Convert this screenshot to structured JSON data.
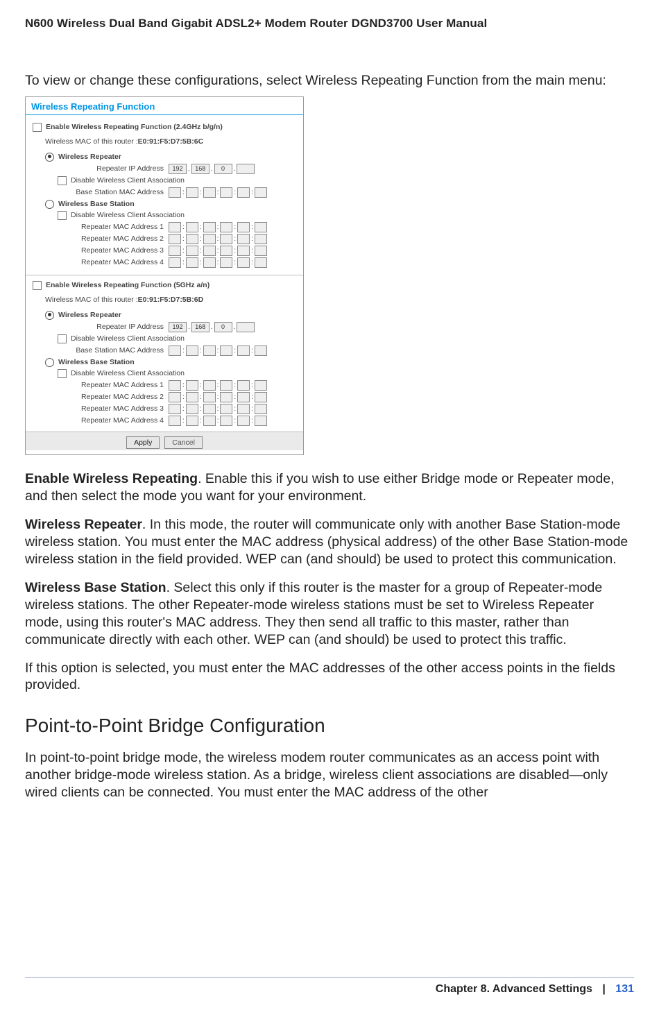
{
  "header": {
    "title": "N600 Wireless Dual Band Gigabit ADSL2+ Modem Router DGND3700 User Manual"
  },
  "intro": "To view or change these configurations, select Wireless Repeating Function from the main menu:",
  "screenshot": {
    "title": "Wireless Repeating Function",
    "band24": {
      "enable_label": "Enable Wireless Repeating Function (2.4GHz b/g/n)",
      "mac_line_prefix": "Wireless MAC of this router : ",
      "mac_value": "E0:91:F5:D7:5B:6C",
      "repeater_label": "Wireless Repeater",
      "repeater_ip_label": "Repeater IP Address",
      "ip_octets": [
        "192",
        "168",
        "0",
        ""
      ],
      "disable_assoc_label": "Disable Wireless Client Association",
      "base_mac_label": "Base Station MAC Address",
      "base_station_label": "Wireless Base Station",
      "rep_mac_labels": [
        "Repeater MAC Address 1",
        "Repeater MAC Address 2",
        "Repeater MAC Address 3",
        "Repeater MAC Address 4"
      ]
    },
    "band5": {
      "enable_label": "Enable Wireless Repeating Function (5GHz a/n)",
      "mac_line_prefix": "Wireless MAC of this router : ",
      "mac_value": "E0:91:F5:D7:5B:6D",
      "repeater_label": "Wireless Repeater",
      "repeater_ip_label": "Repeater IP Address",
      "ip_octets": [
        "192",
        "168",
        "0",
        ""
      ],
      "disable_assoc_label": "Disable Wireless Client Association",
      "base_mac_label": "Base Station MAC Address",
      "base_station_label": "Wireless Base Station",
      "rep_mac_labels": [
        "Repeater MAC Address 1",
        "Repeater MAC Address 2",
        "Repeater MAC Address 3",
        "Repeater MAC Address 4"
      ]
    },
    "buttons": {
      "apply": "Apply",
      "cancel": "Cancel"
    }
  },
  "paras": {
    "p1_strong": "Enable Wireless Repeating",
    "p1_rest": ". Enable this if you wish to use either Bridge mode or Repeater mode, and then select the mode you want for your environment.",
    "p2_strong": "Wireless Repeater",
    "p2_rest": ". In this mode, the router will communicate only with another Base Station-mode wireless station. You must enter the MAC address (physical address) of the other Base Station-mode wireless station in the field provided. WEP can (and should) be used to protect this communication.",
    "p3_strong": "Wireless Base Station",
    "p3_rest": ". Select this only if this router is the master for a group of Repeater-mode wireless stations. The other Repeater-mode wireless stations must be set to Wireless Repeater mode, using this router's MAC address. They then send all traffic to this master, rather than communicate directly with each other. WEP can (and should) be used to protect this traffic.",
    "p4": "If this option is selected, you must enter the MAC addresses of the other access points in the fields provided."
  },
  "subhead": "Point-to-Point Bridge Configuration",
  "subpara": "In point-to-point bridge mode, the wireless modem router communicates as an access point with another bridge-mode wireless station. As a bridge, wireless client associations are disabled—only wired clients can be connected. You must enter the MAC address of the other",
  "footer": {
    "chapter": "Chapter 8.  Advanced Settings",
    "sep": "|",
    "page": "131"
  }
}
